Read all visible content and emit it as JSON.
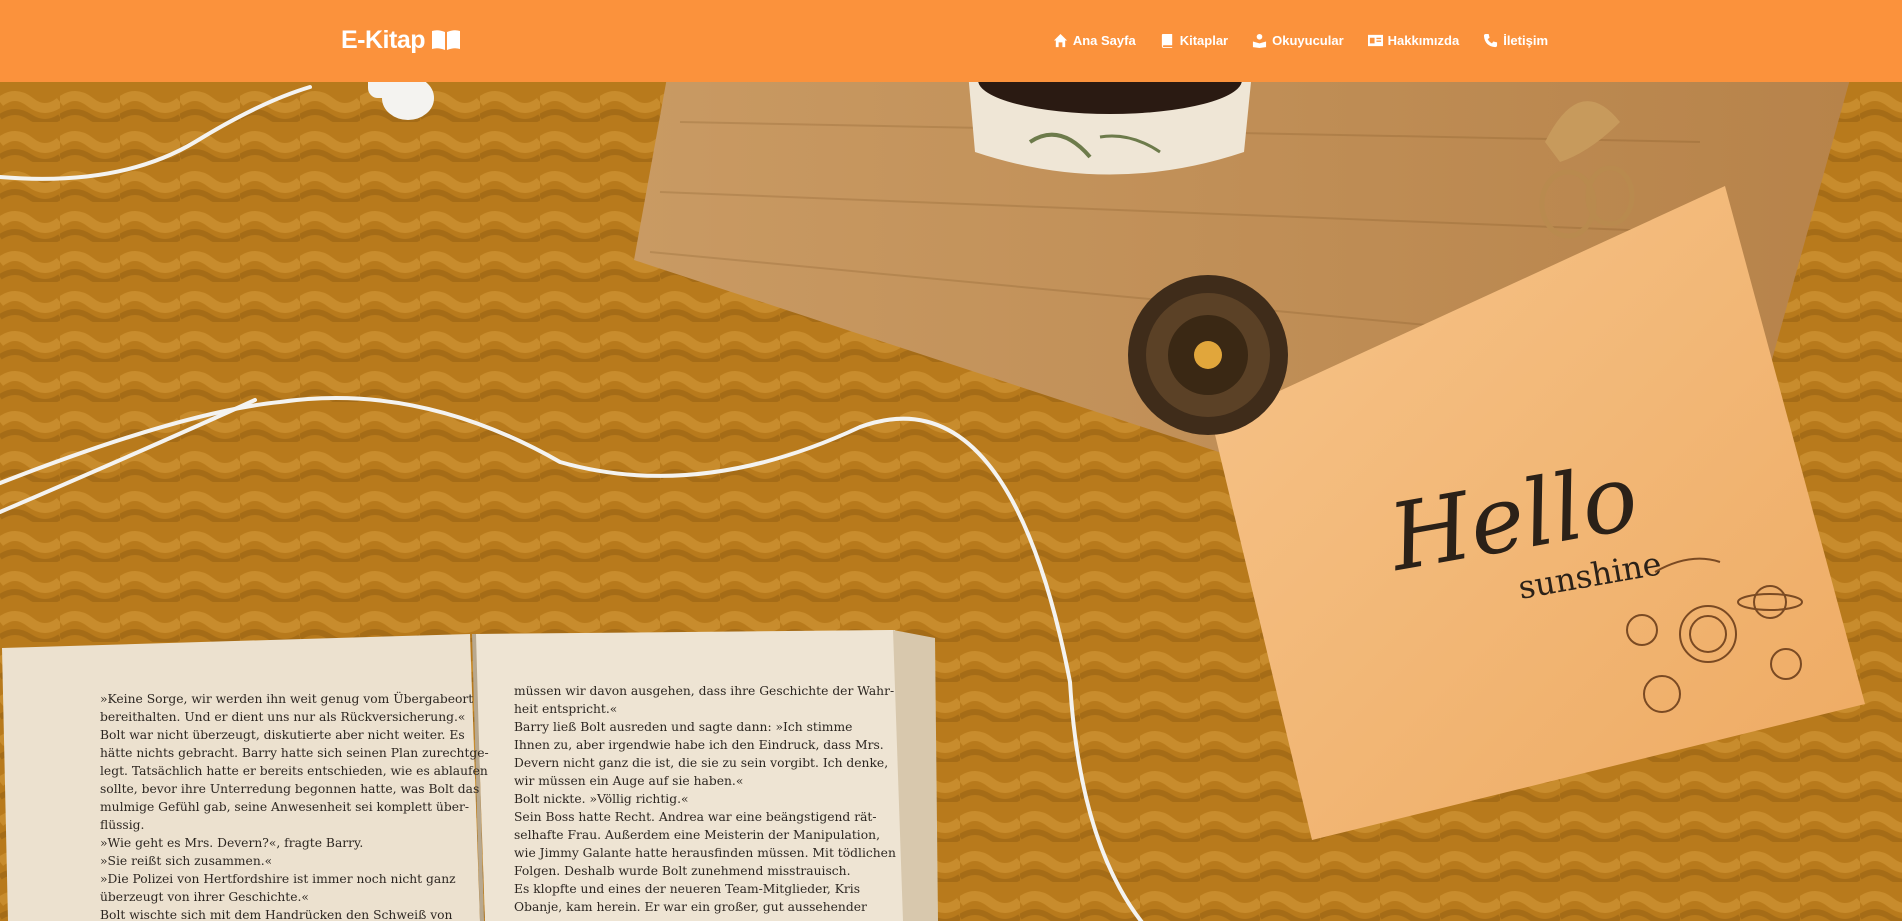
{
  "brand": {
    "name": "E-Kitap",
    "icon": "open-book-icon"
  },
  "nav": {
    "items": [
      {
        "label": "Ana Sayfa",
        "icon": "home-icon"
      },
      {
        "label": "Kitaplar",
        "icon": "book-icon"
      },
      {
        "label": "Okuyucular",
        "icon": "readers-icon"
      },
      {
        "label": "Hakkımızda",
        "icon": "id-card-icon"
      },
      {
        "label": "İletişim",
        "icon": "phone-icon"
      }
    ]
  },
  "hero": {
    "card_title": "Hello",
    "card_subtitle": "sunshine",
    "book_left_lines": [
      "»Keine Sorge, wir werden ihn weit genug vom Übergabeort",
      "bereithalten. Und er dient uns nur als Rückversicherung.«",
      "Bolt war nicht überzeugt, diskutierte aber nicht weiter. Es",
      "hätte nichts gebracht. Barry hatte sich seinen Plan zurechtge-",
      "legt. Tatsächlich hatte er bereits entschieden, wie es ablaufen",
      "sollte, bevor ihre Unterredung begonnen hatte, was Bolt das",
      "mulmige Gefühl gab, seine Anwesenheit sei komplett über-",
      "flüssig.",
      "»Wie geht es Mrs. Devern?«, fragte Barry.",
      "»Sie reißt sich zusammen.«",
      "»Die Polizei von Hertfordshire ist immer noch nicht ganz",
      "überzeugt von ihrer Geschichte.«",
      "Bolt wischte sich mit dem Handrücken den Schweiß von"
    ],
    "book_right_lines": [
      "müssen wir davon ausgehen, dass ihre Geschichte der Wahr-",
      "heit entspricht.«",
      "Barry ließ Bolt ausreden und sagte dann: »Ich stimme",
      "Ihnen zu, aber irgendwie habe ich den Eindruck, dass Mrs.",
      "Devern nicht ganz die ist, die sie zu sein vorgibt. Ich denke,",
      "wir müssen ein Auge auf sie haben.«",
      "Bolt nickte. »Völlig richtig.«",
      "Sein Boss hatte Recht. Andrea war eine beängstigend rät-",
      "selhafte Frau. Außerdem eine Meisterin der Manipulation,",
      "wie Jimmy Galante hatte herausfinden müssen. Mit tödlichen",
      "Folgen. Deshalb wurde Bolt zunehmend misstrauisch.",
      "Es klopfte und eines der neueren Team-Mitglieder, Kris",
      "Obanje, kam herein. Er war ein großer, gut aussehender"
    ]
  },
  "colors": {
    "navbar": "#fb923c",
    "nav_text": "#ffffff",
    "blanket": "#b87a1c",
    "board": "#c99a63",
    "card": "#f2b676",
    "page": "#ece1cf"
  }
}
